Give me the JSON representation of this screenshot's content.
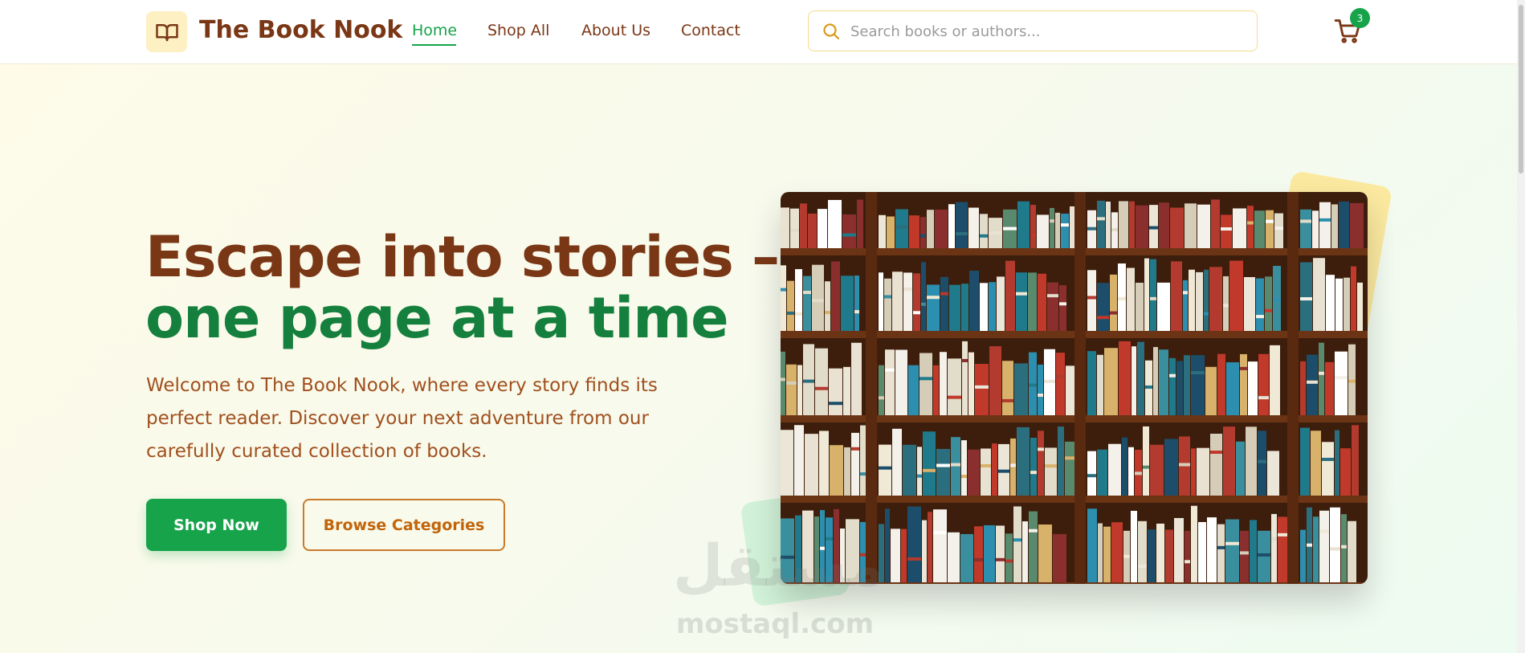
{
  "brand": {
    "name": "The Book Nook",
    "icon": "open-book-icon"
  },
  "nav": {
    "items": [
      {
        "label": "Home",
        "active": true
      },
      {
        "label": "Shop All",
        "active": false
      },
      {
        "label": "About Us",
        "active": false
      },
      {
        "label": "Contact",
        "active": false
      }
    ]
  },
  "search": {
    "placeholder": "Search books or authors...",
    "icon": "search-icon"
  },
  "cart": {
    "icon": "cart-icon",
    "count": "3"
  },
  "hero": {
    "title_line1": "Escape into stories –",
    "title_line2": "one page at a time",
    "description": "Welcome to The Book Nook, where every story finds its perfect reader. Discover your next adventure from our carefully curated collection of books.",
    "primary_button": "Shop Now",
    "secondary_button": "Browse Categories",
    "image": "bookshelf-photo"
  },
  "watermark": {
    "arabic": "مستقل",
    "latin": "mostaql.com"
  },
  "colors": {
    "brand_brown": "#7a3716",
    "accent_green": "#16a34a",
    "text_orange": "#a0501e",
    "outline_orange": "#c97a2a",
    "logo_bg": "#fdf0c3"
  }
}
